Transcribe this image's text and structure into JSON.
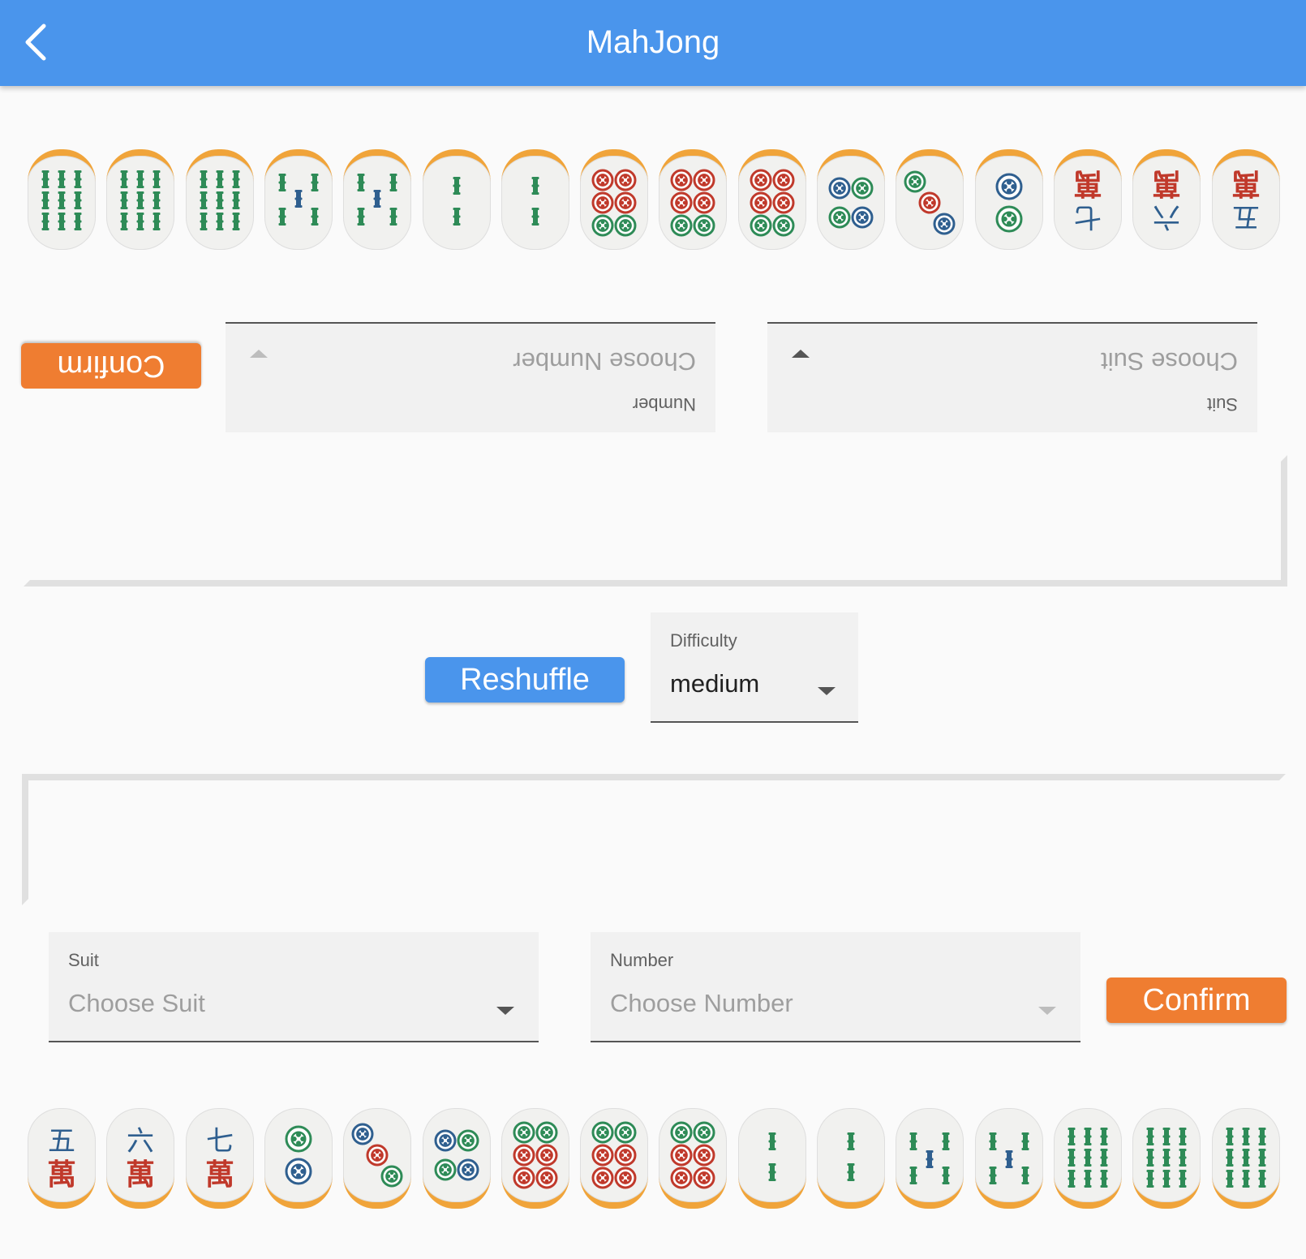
{
  "app_bar": {
    "title": "MahJong"
  },
  "opponent": {
    "tiles": [
      {
        "suit": "bamboo",
        "rank": 9
      },
      {
        "suit": "bamboo",
        "rank": 9
      },
      {
        "suit": "bamboo",
        "rank": 9
      },
      {
        "suit": "bamboo",
        "rank": 5
      },
      {
        "suit": "bamboo",
        "rank": 5
      },
      {
        "suit": "bamboo",
        "rank": 2
      },
      {
        "suit": "bamboo",
        "rank": 2
      },
      {
        "suit": "dots",
        "rank": 6
      },
      {
        "suit": "dots",
        "rank": 6
      },
      {
        "suit": "dots",
        "rank": 6
      },
      {
        "suit": "dots",
        "rank": 4
      },
      {
        "suit": "dots",
        "rank": 3
      },
      {
        "suit": "dots",
        "rank": 2
      },
      {
        "suit": "characters",
        "rank": 7,
        "numeral": "七",
        "glyph": "萬"
      },
      {
        "suit": "characters",
        "rank": 6,
        "numeral": "六",
        "glyph": "萬"
      },
      {
        "suit": "characters",
        "rank": 5,
        "numeral": "五",
        "glyph": "萬"
      }
    ],
    "suit_field": {
      "label": "Suit",
      "placeholder": "Choose Suit"
    },
    "number_field": {
      "label": "Number",
      "placeholder": "Choose Number"
    },
    "confirm_label": "Confirm"
  },
  "controls": {
    "reshuffle_label": "Reshuffle",
    "difficulty": {
      "label": "Difficulty",
      "value": "medium"
    }
  },
  "player": {
    "suit_field": {
      "label": "Suit",
      "placeholder": "Choose Suit"
    },
    "number_field": {
      "label": "Number",
      "placeholder": "Choose Number"
    },
    "confirm_label": "Confirm",
    "tiles": [
      {
        "suit": "characters",
        "rank": 5,
        "numeral": "五",
        "glyph": "萬"
      },
      {
        "suit": "characters",
        "rank": 6,
        "numeral": "六",
        "glyph": "萬"
      },
      {
        "suit": "characters",
        "rank": 7,
        "numeral": "七",
        "glyph": "萬"
      },
      {
        "suit": "dots",
        "rank": 2
      },
      {
        "suit": "dots",
        "rank": 3
      },
      {
        "suit": "dots",
        "rank": 4
      },
      {
        "suit": "dots",
        "rank": 6
      },
      {
        "suit": "dots",
        "rank": 6
      },
      {
        "suit": "dots",
        "rank": 6
      },
      {
        "suit": "bamboo",
        "rank": 2
      },
      {
        "suit": "bamboo",
        "rank": 2
      },
      {
        "suit": "bamboo",
        "rank": 5
      },
      {
        "suit": "bamboo",
        "rank": 5
      },
      {
        "suit": "bamboo",
        "rank": 9
      },
      {
        "suit": "bamboo",
        "rank": 9
      },
      {
        "suit": "bamboo",
        "rank": 9
      }
    ]
  },
  "colors": {
    "app_bar": "#4a95ec",
    "confirm": "#ef7d31",
    "reshuffle": "#4a95ec",
    "tile_edge": "#f0a43a",
    "green": "#2e8b57",
    "blue": "#2f5f8f",
    "red": "#c0392b"
  },
  "icons": {
    "back": "chevron-left-icon",
    "dropdown": "caret-down-icon"
  }
}
